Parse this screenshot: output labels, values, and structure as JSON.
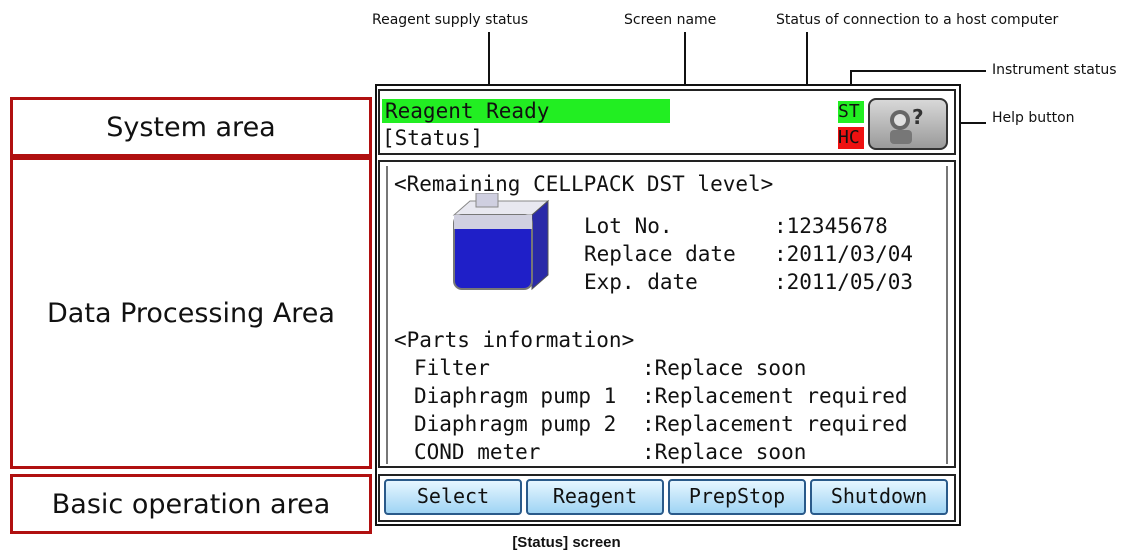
{
  "annotations": {
    "reagent_supply_status": "Reagent supply status",
    "screen_name": "Screen name",
    "host_connection_status": "Status of connection to a host computer",
    "instrument_status": "Instrument status",
    "help_button": "Help button"
  },
  "regions": {
    "system_area": "System area",
    "data_processing_area": "Data Processing Area",
    "basic_operation_area": "Basic operation area"
  },
  "system": {
    "reagent_status": "Reagent Ready",
    "screen_name": "[Status]",
    "instrument_status": "ST",
    "host_status": "HC",
    "colors": {
      "ready_green": "#22ee22",
      "alert_red": "#ee1111"
    }
  },
  "reagent": {
    "heading": "<Remaining CELLPACK DST level>",
    "lot_label": "Lot No.",
    "lot_value": ":12345678",
    "replace_label": "Replace date",
    "replace_value": ":2011/03/04",
    "exp_label": "Exp. date",
    "exp_value": ":2011/05/03"
  },
  "parts": {
    "heading": "<Parts information>",
    "items": [
      {
        "name": "Filter",
        "status": ":Replace soon"
      },
      {
        "name": "Diaphragm pump 1",
        "status": ":Replacement required"
      },
      {
        "name": "Diaphragm pump 2",
        "status": ":Replacement required"
      },
      {
        "name": "COND meter",
        "status": ":Replace soon"
      }
    ]
  },
  "buttons": [
    "Select",
    "Reagent",
    "PrepStop",
    "Shutdown"
  ],
  "caption": "[Status] screen"
}
